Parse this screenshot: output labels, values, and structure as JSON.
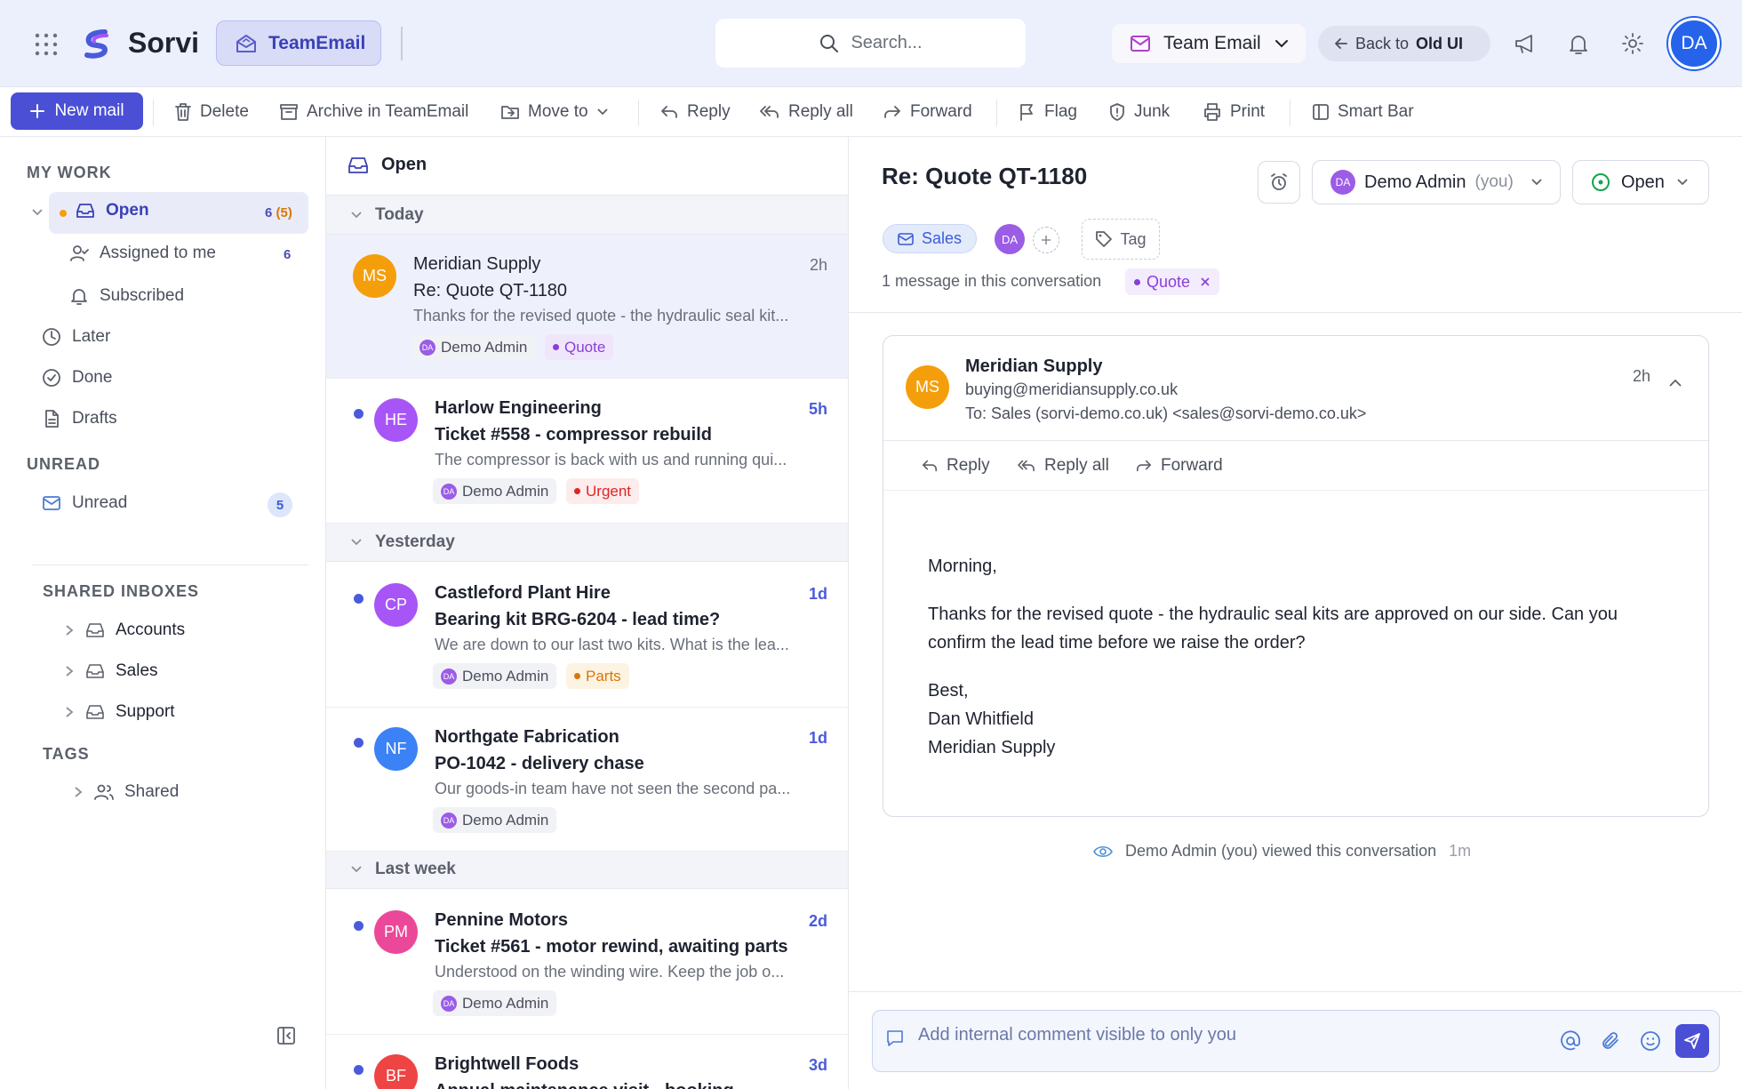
{
  "app": {
    "brand": "Sorvi",
    "module": "TeamEmail"
  },
  "header": {
    "search_placeholder": "Search...",
    "mailbox_switcher": "Team Email",
    "back_prefix": "Back to",
    "back_target": "Old UI",
    "user_initials": "DA"
  },
  "toolbar": {
    "new_mail": "New mail",
    "delete": "Delete",
    "archive": "Archive in TeamEmail",
    "move_to": "Move to",
    "reply": "Reply",
    "reply_all": "Reply all",
    "forward": "Forward",
    "flag": "Flag",
    "junk": "Junk",
    "print": "Print",
    "smart_bar": "Smart Bar"
  },
  "sidebar": {
    "my_work_heading": "MY WORK",
    "open": {
      "label": "Open",
      "count": "6",
      "count_unread": "(5)"
    },
    "assigned": {
      "label": "Assigned to me",
      "count": "6"
    },
    "subscribed": {
      "label": "Subscribed"
    },
    "later": {
      "label": "Later"
    },
    "done": {
      "label": "Done"
    },
    "drafts": {
      "label": "Drafts"
    },
    "unread_heading": "UNREAD",
    "unread": {
      "label": "Unread",
      "count": "5"
    },
    "shared_heading": "SHARED INBOXES",
    "shared": [
      "Accounts",
      "Sales",
      "Support"
    ],
    "tags_heading": "TAGS",
    "tags": [
      "Shared"
    ]
  },
  "list": {
    "title": "Open",
    "groups": {
      "today": "Today",
      "yesterday": "Yesterday",
      "last_week": "Last week"
    },
    "items": [
      {
        "initials": "MS",
        "sender": "Meridian Supply",
        "time": "2h",
        "subject": "Re: Quote QT-1180",
        "preview": "Thanks for the revised quote - the hydraulic seal kit...",
        "assignee": "Demo Admin",
        "assignee_initials": "DA",
        "tag": "Quote",
        "color": "#f59e0b",
        "tag_color": "#8b3fd6",
        "tag_bg": "#efe6fb"
      },
      {
        "initials": "HE",
        "sender": "Harlow Engineering",
        "time": "5h",
        "subject": "Ticket #558 - compressor rebuild",
        "preview": "The compressor is back with us and running qui...",
        "assignee": "Demo Admin",
        "assignee_initials": "DA",
        "tag": "Urgent",
        "color": "#a855f7",
        "tag_color": "#dc2626",
        "tag_bg": "#fdecec"
      },
      {
        "initials": "CP",
        "sender": "Castleford Plant Hire",
        "time": "1d",
        "subject": "Bearing kit BRG-6204 - lead time?",
        "preview": "We are down to our last two kits. What is the lea...",
        "assignee": "Demo Admin",
        "assignee_initials": "DA",
        "tag": "Parts",
        "color": "#a855f7",
        "tag_color": "#d97706",
        "tag_bg": "#fdf3e3"
      },
      {
        "initials": "NF",
        "sender": "Northgate Fabrication",
        "time": "1d",
        "subject": "PO-1042 - delivery chase",
        "preview": "Our goods-in team have not seen the second pa...",
        "assignee": "Demo Admin",
        "assignee_initials": "DA",
        "color": "#3b82f6"
      },
      {
        "initials": "PM",
        "sender": "Pennine Motors",
        "time": "2d",
        "subject": "Ticket #561 - motor rewind, awaiting parts",
        "preview": "Understood on the winding wire. Keep the job o...",
        "assignee": "Demo Admin",
        "assignee_initials": "DA",
        "color": "#ec4899"
      },
      {
        "initials": "BF",
        "sender": "Brightwell Foods",
        "time": "3d",
        "subject": "Annual maintenance visit - booking",
        "color": "#ef4444"
      }
    ]
  },
  "detail": {
    "subject": "Re: Quote QT-1180",
    "assignee": "Demo Admin",
    "assignee_suffix": "(you)",
    "assignee_initials": "DA",
    "status": "Open",
    "inbox_chip": "Sales",
    "tag_button": "Tag",
    "conversation_count": "1 message in this conversation",
    "conversation_tag": "Quote",
    "message": {
      "initials": "MS",
      "sender": "Meridian Supply",
      "email": "buying@meridiansupply.co.uk",
      "to": "To: Sales (sorvi-demo.co.uk) <sales@sorvi-demo.co.uk>",
      "time": "2h",
      "reply": "Reply",
      "reply_all": "Reply all",
      "forward": "Forward",
      "greeting": "Morning,",
      "body": "Thanks for the revised quote - the hydraulic seal kits are approved on our side. Can you confirm the lead time before we raise the order?",
      "signoff": "Best,",
      "sig_name": "Dan Whitfield",
      "sig_company": "Meridian Supply"
    },
    "activity": "Demo Admin (you) viewed this conversation",
    "activity_time": "1m",
    "comment_placeholder": "Add internal comment visible to only you"
  },
  "colors": {
    "accent": "#4a4fd6",
    "topbar_bg": "#eceffc",
    "selected_row": "#eef1fb"
  }
}
